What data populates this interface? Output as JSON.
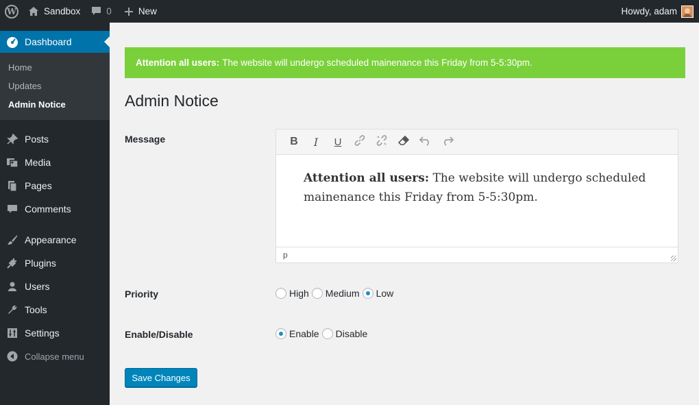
{
  "adminbar": {
    "site_name": "Sandbox",
    "comments_count": "0",
    "new_label": "New",
    "howdy": "Howdy, adam"
  },
  "sidebar": {
    "dashboard": "Dashboard",
    "submenu": [
      "Home",
      "Updates",
      "Admin Notice"
    ],
    "items": [
      {
        "label": "Posts",
        "icon": "pushpin-icon"
      },
      {
        "label": "Media",
        "icon": "media-icon"
      },
      {
        "label": "Pages",
        "icon": "pages-icon"
      },
      {
        "label": "Comments",
        "icon": "comment-icon"
      },
      {
        "label": "Appearance",
        "icon": "brush-icon"
      },
      {
        "label": "Plugins",
        "icon": "plugin-icon"
      },
      {
        "label": "Users",
        "icon": "user-icon"
      },
      {
        "label": "Tools",
        "icon": "wrench-icon"
      },
      {
        "label": "Settings",
        "icon": "settings-icon"
      }
    ],
    "collapse": "Collapse menu"
  },
  "notice": {
    "bold": "Attention all users:",
    "text": "The website will undergo scheduled mainenance this Friday from 5-5:30pm.",
    "color": "#7ad03a"
  },
  "page_title": "Admin Notice",
  "form": {
    "message_label": "Message",
    "editor_bold": "Attention all users:",
    "editor_text": "The website will undergo scheduled mainenance this Friday from 5-5:30pm.",
    "editor_path": "p",
    "priority_label": "Priority",
    "priority_options": [
      "High",
      "Medium",
      "Low"
    ],
    "priority_selected": "Low",
    "enable_label": "Enable/Disable",
    "enable_options": [
      "Enable",
      "Disable"
    ],
    "enable_selected": "Enable",
    "save_label": "Save Changes"
  },
  "colors": {
    "admin_dark": "#23282d",
    "accent": "#0073aa",
    "button": "#0085ba"
  }
}
